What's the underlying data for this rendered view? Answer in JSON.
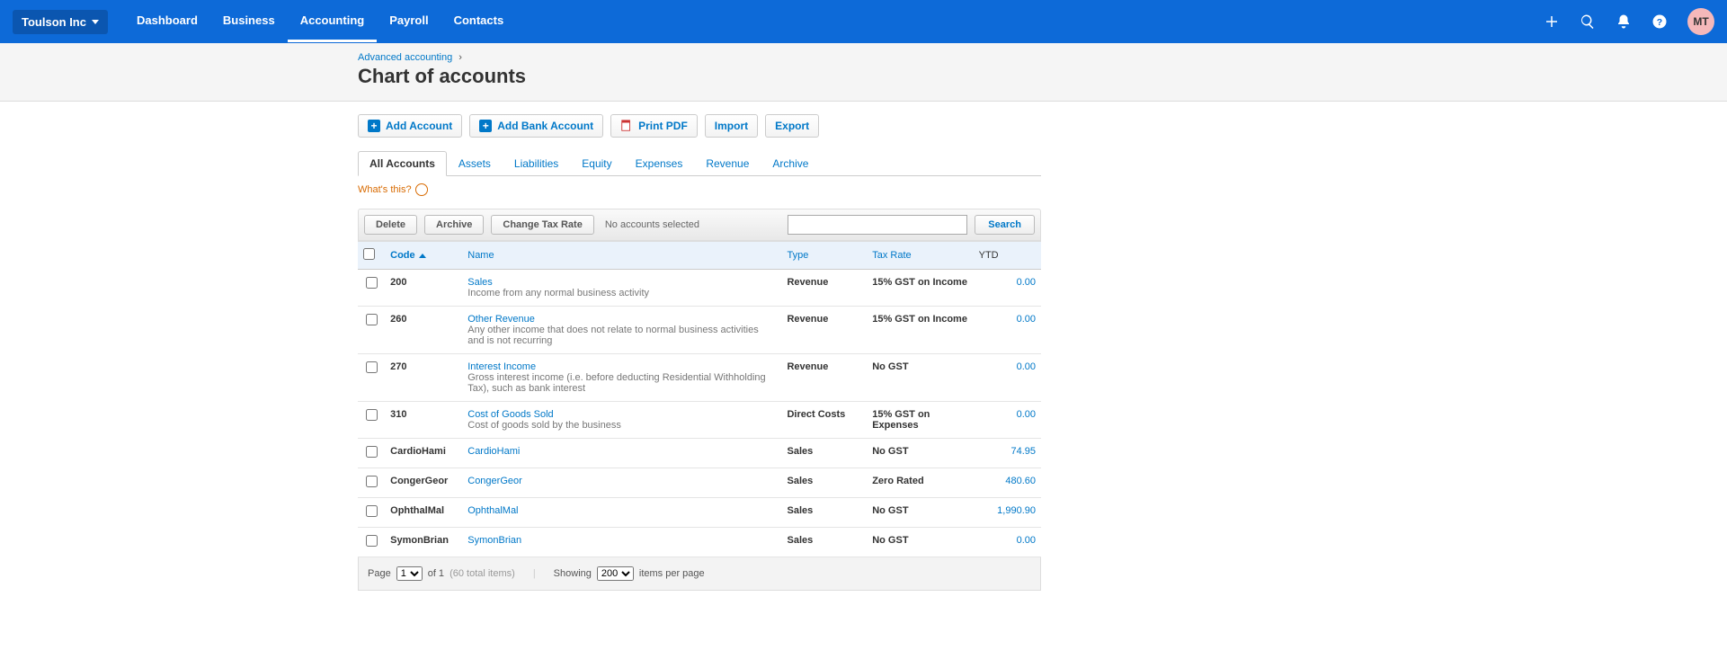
{
  "nav": {
    "org_name": "Toulson Inc",
    "links": [
      "Dashboard",
      "Business",
      "Accounting",
      "Payroll",
      "Contacts"
    ],
    "active_index": 2,
    "avatar_initials": "MT"
  },
  "breadcrumb": {
    "parent": "Advanced accounting"
  },
  "page_title": "Chart of accounts",
  "buttons": {
    "add_account": "Add Account",
    "add_bank_account": "Add Bank Account",
    "print_pdf": "Print PDF",
    "import": "Import",
    "export": "Export"
  },
  "tabs": [
    "All Accounts",
    "Assets",
    "Liabilities",
    "Equity",
    "Expenses",
    "Revenue",
    "Archive"
  ],
  "active_tab_index": 0,
  "whats_this": "What's this?",
  "toolbar": {
    "delete": "Delete",
    "archive": "Archive",
    "change_tax_rate": "Change Tax Rate",
    "no_selected": "No accounts selected",
    "search": "Search"
  },
  "columns": {
    "code": "Code",
    "name": "Name",
    "type": "Type",
    "tax_rate": "Tax Rate",
    "ytd": "YTD"
  },
  "rows": [
    {
      "code": "200",
      "name": "Sales",
      "desc": "Income from any normal business activity",
      "type": "Revenue",
      "tax": "15% GST on Income",
      "ytd": "0.00"
    },
    {
      "code": "260",
      "name": "Other Revenue",
      "desc": "Any other income that does not relate to normal business activities and is not recurring",
      "type": "Revenue",
      "tax": "15% GST on Income",
      "ytd": "0.00"
    },
    {
      "code": "270",
      "name": "Interest Income",
      "desc": "Gross interest income (i.e. before deducting Residential Withholding Tax), such as bank interest",
      "type": "Revenue",
      "tax": "No GST",
      "ytd": "0.00"
    },
    {
      "code": "310",
      "name": "Cost of Goods Sold",
      "desc": "Cost of goods sold by the business",
      "type": "Direct Costs",
      "tax": "15% GST on Expenses",
      "ytd": "0.00"
    },
    {
      "code": "CardioHami",
      "name": "CardioHami",
      "desc": "",
      "type": "Sales",
      "tax": "No GST",
      "ytd": "74.95"
    },
    {
      "code": "CongerGeor",
      "name": "CongerGeor",
      "desc": "",
      "type": "Sales",
      "tax": "Zero Rated",
      "ytd": "480.60"
    },
    {
      "code": "OphthalMal",
      "name": "OphthalMal",
      "desc": "",
      "type": "Sales",
      "tax": "No GST",
      "ytd": "1,990.90"
    },
    {
      "code": "SymonBrian",
      "name": "SymonBrian",
      "desc": "",
      "type": "Sales",
      "tax": "No GST",
      "ytd": "0.00"
    }
  ],
  "pager": {
    "page_label": "Page",
    "page_current": "1",
    "of_label": "of 1",
    "total_items": "(60 total items)",
    "showing_label": "Showing",
    "per_page_value": "200",
    "items_per_page": "items per page"
  }
}
